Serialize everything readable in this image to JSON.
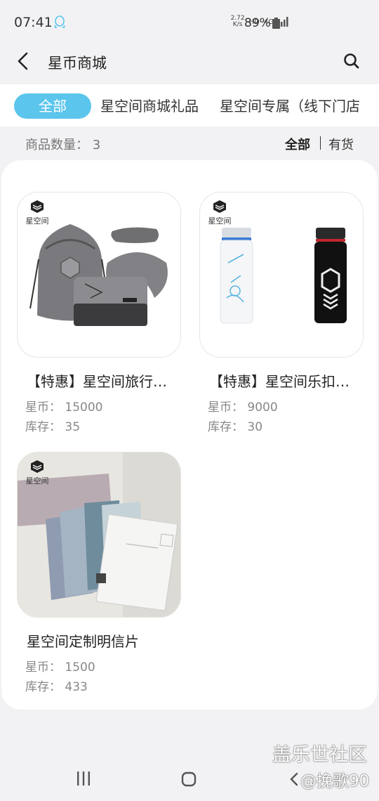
{
  "status_bar": {
    "time": "07:41",
    "speed_value": "2.72",
    "speed_unit": "K/s",
    "hd": "HD",
    "network": "4G",
    "battery": "89%"
  },
  "header": {
    "title": "星币商城",
    "back_icon": "chevron-left-icon",
    "search_icon": "search-icon"
  },
  "tabs": [
    {
      "label": "全部",
      "active": true
    },
    {
      "label": "星空间商城礼品",
      "active": false
    },
    {
      "label": "星空间专属（线下门店",
      "active": false
    }
  ],
  "filter": {
    "count_label": "商品数量：",
    "count_value": "3",
    "all_label": "全部",
    "in_stock_label": "有货"
  },
  "brand_label": "星空间",
  "products": [
    {
      "title": "【特惠】星空间旅行…",
      "price_label": "星币：",
      "price": "15000",
      "stock_label": "库存：",
      "stock": "35"
    },
    {
      "title": "【特惠】星空间乐扣…",
      "price_label": "星币：",
      "price": "9000",
      "stock_label": "库存：",
      "stock": "30"
    },
    {
      "title": "星空间定制明信片",
      "price_label": "星币：",
      "price": "1500",
      "stock_label": "库存：",
      "stock": "433"
    }
  ],
  "watermark": {
    "line1": "盖乐世社区",
    "line2": "@挽歌90"
  },
  "colors": {
    "accent": "#5bc5ec",
    "background": "#f2f2f4"
  }
}
